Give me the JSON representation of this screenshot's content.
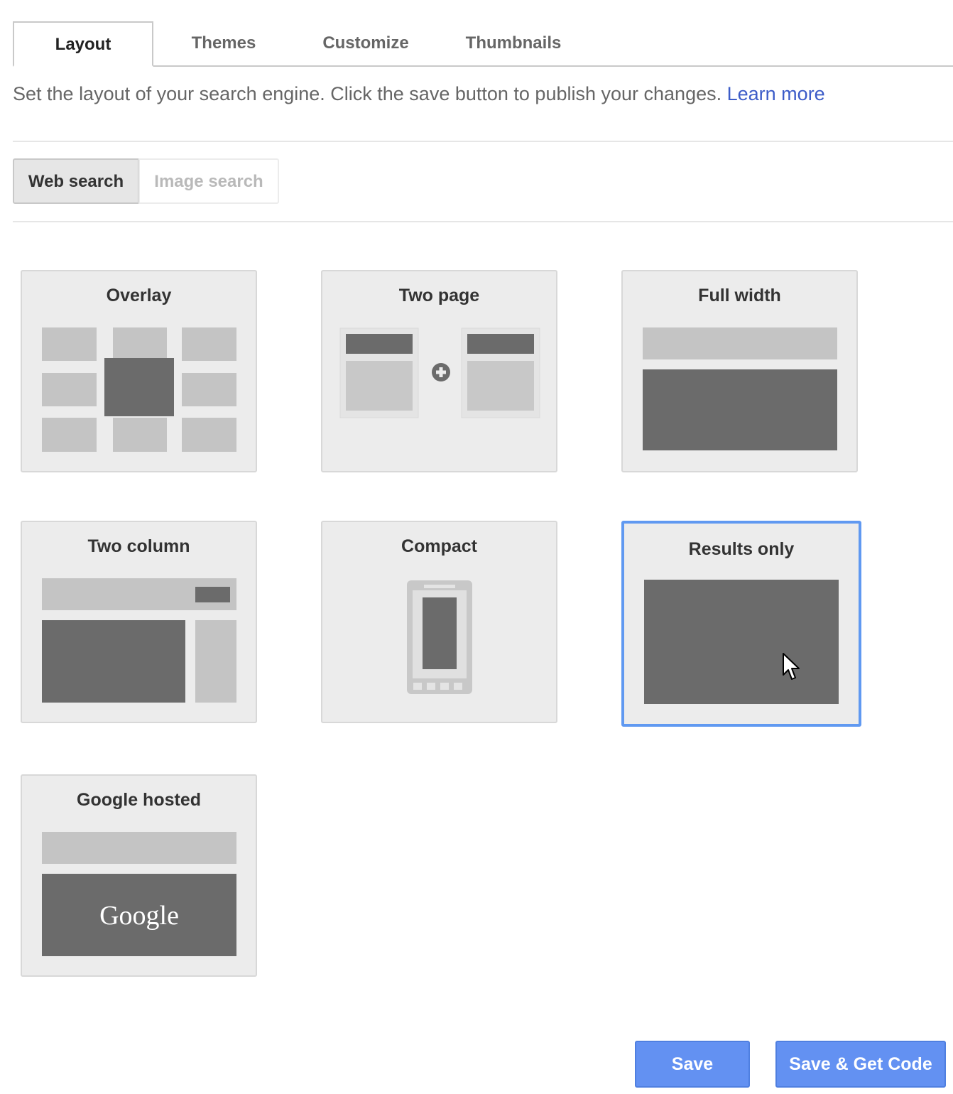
{
  "tabs": [
    {
      "label": "Layout",
      "active": true
    },
    {
      "label": "Themes",
      "active": false
    },
    {
      "label": "Customize",
      "active": false
    },
    {
      "label": "Thumbnails",
      "active": false
    }
  ],
  "description": {
    "text": "Set the layout of your search engine. Click the save button to publish your changes.",
    "link": "Learn more"
  },
  "search_type": {
    "web": "Web search",
    "image": "Image search",
    "selected": "Web search"
  },
  "layouts": [
    {
      "label": "Overlay",
      "icon": "overlay-layout-icon"
    },
    {
      "label": "Two page",
      "icon": "two-page-layout-icon"
    },
    {
      "label": "Full width",
      "icon": "full-width-layout-icon"
    },
    {
      "label": "Two column",
      "icon": "two-column-layout-icon"
    },
    {
      "label": "Compact",
      "icon": "compact-layout-icon"
    },
    {
      "label": "Results only",
      "icon": "results-only-layout-icon",
      "selected": true
    },
    {
      "label": "Google hosted",
      "icon": "google-hosted-layout-icon",
      "logo_text": "Google"
    }
  ],
  "actions": {
    "save": "Save",
    "save_get_code": "Save & Get Code"
  },
  "colors": {
    "accent": "#6391f2",
    "selected_border": "#6099f1",
    "link": "#3c5cc8",
    "dark_block": "#6b6b6b",
    "light_block": "#c4c4c4"
  }
}
